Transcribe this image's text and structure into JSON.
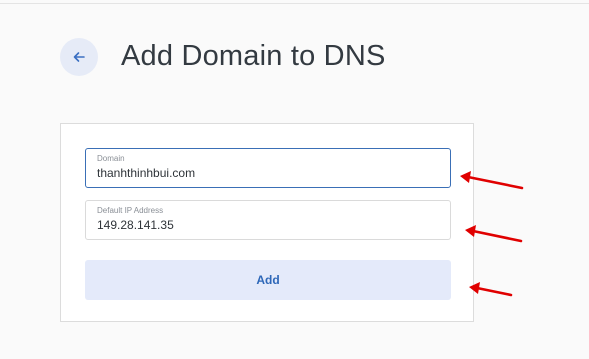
{
  "header": {
    "back_icon": "arrow-left-icon",
    "title": "Add Domain to DNS"
  },
  "form": {
    "domain": {
      "label": "Domain",
      "value": "thanhthinhbui.com"
    },
    "default_ip": {
      "label": "Default IP Address",
      "value": "149.28.141.35"
    },
    "submit_label": "Add"
  },
  "colors": {
    "accent": "#2d67b8",
    "back_button_bg": "#e6ebf7",
    "add_button_bg": "#e4eafa",
    "annotation_arrow": "#e00000"
  }
}
